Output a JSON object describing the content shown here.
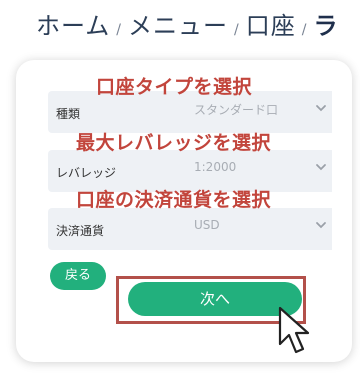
{
  "breadcrumb": {
    "items": [
      "ホーム",
      "メニュー",
      "口座",
      "ラ"
    ],
    "separator": "/"
  },
  "form": {
    "account_type": {
      "label": "種類",
      "value": "スタンダード口"
    },
    "leverage": {
      "label": "レバレッジ",
      "value": "1:2000"
    },
    "currency": {
      "label": "決済通貨",
      "value": "USD"
    }
  },
  "annotations": {
    "select_account_type": "口座タイプを選択",
    "select_max_leverage": "最大レバレッジを選択",
    "select_currency": "口座の決済通貨を選択"
  },
  "buttons": {
    "back": "戻る",
    "next": "次へ"
  },
  "colors": {
    "accent_green": "#22b07d",
    "annotation_red": "#c2453c",
    "highlight_frame": "#b3504a",
    "breadcrumb_text": "#2c3e57"
  },
  "icons": {
    "dropdown": "chevron-down-icon",
    "pointer": "mouse-cursor-icon"
  }
}
